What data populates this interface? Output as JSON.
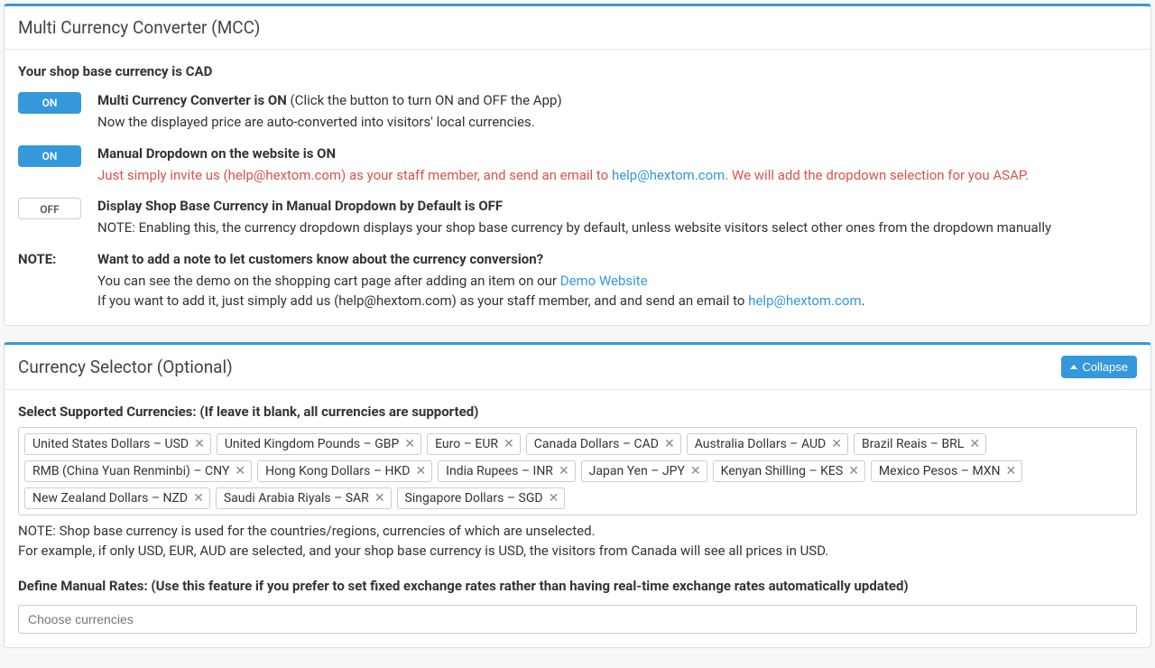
{
  "panel1": {
    "title": "Multi Currency Converter (MCC)",
    "base_currency": "Your shop base currency is CAD",
    "settings": {
      "converter": {
        "toggle": "ON",
        "title_bold": "Multi Currency Converter is ON",
        "title_rest": " (Click the button to turn ON and OFF the App)",
        "desc": "Now the displayed price are auto-converted into visitors' local currencies."
      },
      "dropdown": {
        "toggle": "ON",
        "title_bold": "Manual Dropdown on the website is ON",
        "desc_pre": "Just simply invite us (help@hextom.com) as your staff member, and send an email to ",
        "desc_link": "help@hextom.com",
        "desc_post": ". We will add the dropdown selection for you ASAP."
      },
      "display_base": {
        "toggle": "OFF",
        "title_bold": "Display Shop Base Currency in Manual Dropdown by Default is OFF",
        "desc": "NOTE: Enabling this, the currency dropdown displays your shop base currency by default, unless website visitors select other ones from the dropdown manually"
      },
      "note": {
        "label": "NOTE:",
        "title_bold": "Want to add a note to let customers know about the currency conversion?",
        "line1_pre": "You can see the demo on the shopping cart page after adding an item on our ",
        "line1_link": "Demo Website",
        "line2_pre": "If you want to add it, just simply add us (help@hextom.com) as your staff member, and and send an email to ",
        "line2_link": "help@hextom.com",
        "line2_post": "."
      }
    }
  },
  "panel2": {
    "title": "Currency Selector (Optional)",
    "collapse": "Collapse",
    "select_label": "Select Supported Currencies: (If leave it blank, all currencies are supported)",
    "currencies": [
      "United States Dollars – USD",
      "United Kingdom Pounds – GBP",
      "Euro – EUR",
      "Canada Dollars – CAD",
      "Australia Dollars – AUD",
      "Brazil Reais – BRL",
      "RMB (China Yuan Renminbi) – CNY",
      "Hong Kong Dollars – HKD",
      "India Rupees – INR",
      "Japan Yen – JPY",
      "Kenyan Shilling – KES",
      "Mexico Pesos – MXN",
      "New Zealand Dollars – NZD",
      "Saudi Arabia Riyals – SAR",
      "Singapore Dollars – SGD"
    ],
    "hint1": "NOTE: Shop base currency is used for the countries/regions, currencies of which are unselected.",
    "hint2": "For example, if only USD, EUR, AUD are selected, and your shop base currency is USD, the visitors from Canada will see all prices in USD.",
    "rates_label": "Define Manual Rates: (Use this feature if you prefer to set fixed exchange rates rather than having real-time exchange rates automatically updated)",
    "rates_placeholder": "Choose currencies"
  }
}
